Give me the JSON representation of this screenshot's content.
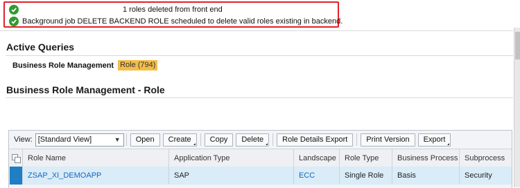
{
  "messages": [
    {
      "type": "success",
      "text": "1 roles deleted from front end"
    },
    {
      "type": "success",
      "text": "Background job DELETE BACKEND ROLE scheduled to delete valid roles existing in backend."
    }
  ],
  "active_queries": {
    "title": "Active Queries",
    "label": "Business Role Management",
    "link": "Role (794)"
  },
  "table_title": "Business Role Management - Role",
  "toolbar": {
    "view_label": "View:",
    "view_value": "[Standard View]",
    "buttons": [
      "Open",
      "Create",
      "Copy",
      "Delete",
      "Role Details Export",
      "Print Version",
      "Export"
    ]
  },
  "columns": [
    "Role Name",
    "Application Type",
    "Landscape",
    "Role Type",
    "Business Process",
    "Subprocess"
  ],
  "rows": [
    {
      "role_name": "ZSAP_XI_DEMOAPP",
      "application_type": "SAP",
      "landscape": "ECC",
      "role_type": "Single Role",
      "business_process": "Basis",
      "subprocess": "Security"
    }
  ],
  "colors": {
    "error_border": "#e0202a",
    "success_icon": "#2e9b2e",
    "highlight": "#f4bd49",
    "selected_row": "#d9ecf8",
    "row_marker": "#1f7ec4",
    "link": "#1565c0"
  }
}
